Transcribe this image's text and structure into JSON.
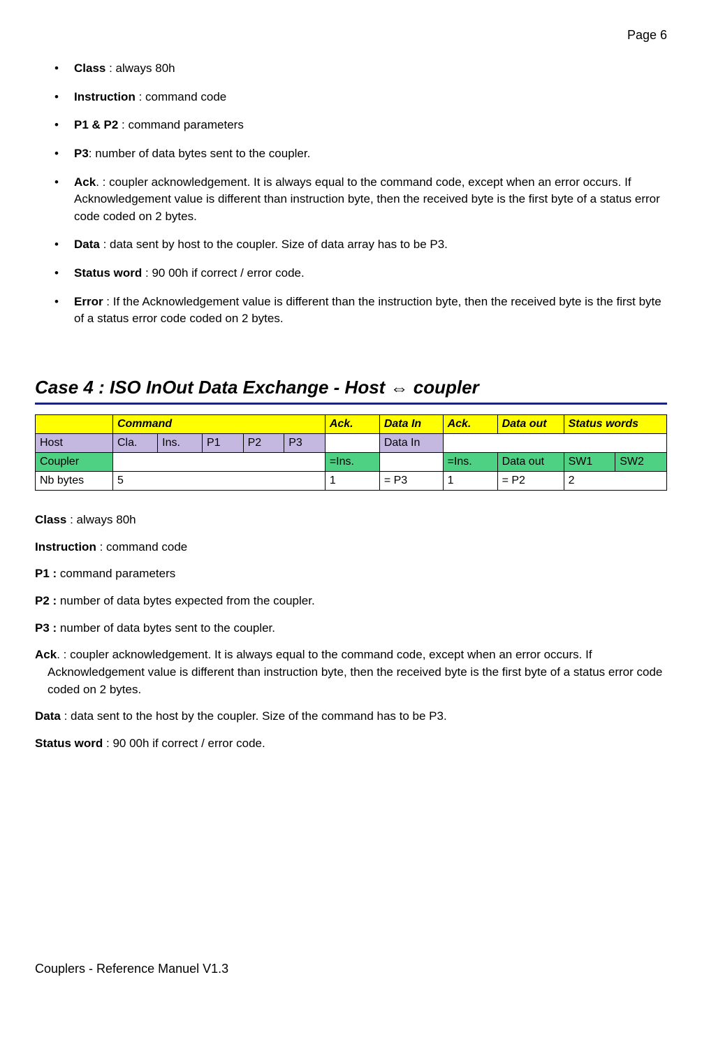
{
  "page_label": "Page 6",
  "top_defs": [
    {
      "term": "Class",
      "sep": " : ",
      "text": "always 80h"
    },
    {
      "term": "Instruction",
      "sep": " : ",
      "text": "command code"
    },
    {
      "term": "P1 & P2",
      "sep": " : ",
      "text": "command parameters"
    },
    {
      "term": "P3",
      "sep": ": ",
      "text": "number of data bytes sent to the coupler."
    },
    {
      "term": "Ack",
      "sep": ". : ",
      "text": "coupler acknowledgement. It is always equal to the command code, except when an error occurs. If Acknowledgement value is different than instruction byte, then the received byte is the first byte of a status error code coded on 2 bytes."
    },
    {
      "term": "Data",
      "sep": " : ",
      "text": "data sent by host to the coupler. Size of data array has to be P3."
    },
    {
      "term": "Status word",
      "sep": " : ",
      "text": "90 00h if correct / error code."
    },
    {
      "term": "Error",
      "sep": " : ",
      "text": "If the Acknowledgement value is different than the instruction byte, then the received byte is the first byte of a status error code coded on 2 bytes."
    }
  ],
  "section_title": "Case 4 : ISO InOut Data Exchange - Host ⇔ coupler",
  "table": {
    "header": [
      "",
      "Command",
      "Ack.",
      "Data In",
      "Ack.",
      "Data out",
      "Status words"
    ],
    "host_row": [
      "Host",
      "Cla.",
      "Ins.",
      "P1",
      "P2",
      "P3",
      "",
      "Data In",
      "",
      "",
      "",
      ""
    ],
    "coupler_row": [
      "Coupler",
      "",
      "=Ins.",
      "",
      "=Ins.",
      "Data out",
      "SW1",
      "SW2"
    ],
    "nb_row": [
      "Nb bytes",
      "5",
      "1",
      "= P3",
      "1",
      "= P2",
      "2"
    ]
  },
  "bottom_defs": [
    {
      "term": "Class",
      "sep": " : ",
      "text": "always 80h"
    },
    {
      "term": "Instruction",
      "sep": " : ",
      "text": "command code"
    },
    {
      "term": "P1 :",
      "sep": " ",
      "text": "command parameters"
    },
    {
      "term": "P2 :",
      "sep": " ",
      "text": "number of data bytes expected from the coupler."
    },
    {
      "term": "P3 :",
      "sep": " ",
      "text": "number of data bytes sent to the coupler."
    },
    {
      "term": "Ack",
      "sep": ". : ",
      "text": "coupler acknowledgement. It is always equal to the command code, except when an error occurs. If Acknowledgement value is different than instruction byte, then the received byte is the first byte of a status error code coded on 2 bytes."
    },
    {
      "term": "Data",
      "sep": " : ",
      "text": "data sent to the host by the coupler. Size of the command has to be P3."
    },
    {
      "term": "Status word",
      "sep": " : ",
      "text": "90 00h if correct / error code."
    }
  ],
  "footer": "Couplers - Reference Manuel V1.3"
}
